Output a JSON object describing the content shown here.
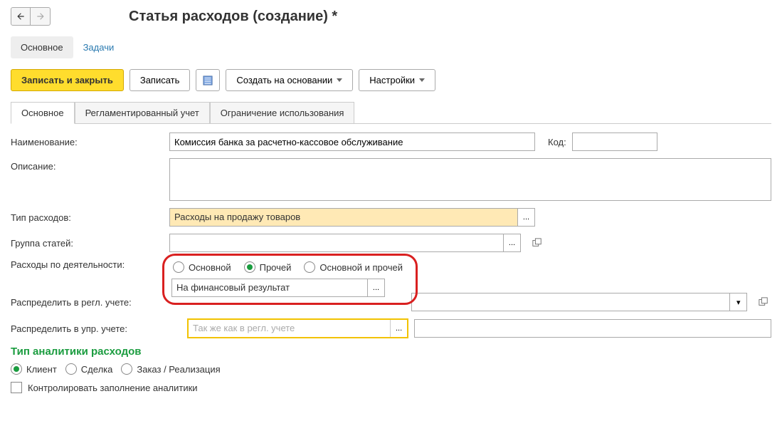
{
  "header": {
    "title": "Статья расходов (создание) *"
  },
  "nav": {
    "main": "Основное",
    "tasks": "Задачи"
  },
  "toolbar": {
    "save_close": "Записать и закрыть",
    "save": "Записать",
    "create_based": "Создать на основании",
    "settings": "Настройки"
  },
  "tabs": {
    "main": "Основное",
    "regl": "Регламентированный учет",
    "restrict": "Ограничение использования"
  },
  "fields": {
    "name_label": "Наименование:",
    "name_value": "Комиссия банка за расчетно-кассовое обслуживание",
    "code_label": "Код:",
    "code_value": "",
    "desc_label": "Описание:",
    "desc_value": "",
    "expense_type_label": "Тип расходов:",
    "expense_type_value": "Расходы на продажу товаров",
    "group_label": "Группа статей:",
    "group_value": "",
    "activity_label": "Расходы по деятельности:",
    "distrib_regl_label": "Распределить в регл. учете:",
    "distrib_regl_value": "На финансовый результат",
    "distrib_upr_label": "Распределить в упр. учете:",
    "distrib_upr_placeholder": "Так же как в регл. учете"
  },
  "activity_radios": {
    "main": "Основной",
    "other": "Прочей",
    "both": "Основной и прочей"
  },
  "analytics": {
    "title": "Тип аналитики расходов",
    "client": "Клиент",
    "deal": "Сделка",
    "order": "Заказ / Реализация",
    "control": "Контролировать заполнение аналитики"
  },
  "select_btn": "...",
  "dropdown_btn": "▾"
}
